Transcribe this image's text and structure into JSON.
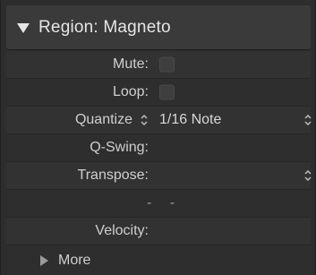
{
  "header": {
    "title": "Region: Magneto",
    "disclosure_icon": "triangle-down-icon"
  },
  "rows": {
    "mute": {
      "label": "Mute:"
    },
    "loop": {
      "label": "Loop:"
    },
    "quantize": {
      "label": "Quantize",
      "value": "1/16 Note"
    },
    "qswing": {
      "label": "Q-Swing:"
    },
    "transpose": {
      "label": "Transpose:"
    },
    "blank": {
      "value": "- -"
    },
    "velocity": {
      "label": "Velocity:"
    },
    "more": {
      "label": "More",
      "disclosure_icon": "triangle-right-icon"
    }
  },
  "colors": {
    "panel_bg": "#2d2d2d",
    "header_bg": "#3a3a3a",
    "text": "#cfcfcf"
  }
}
